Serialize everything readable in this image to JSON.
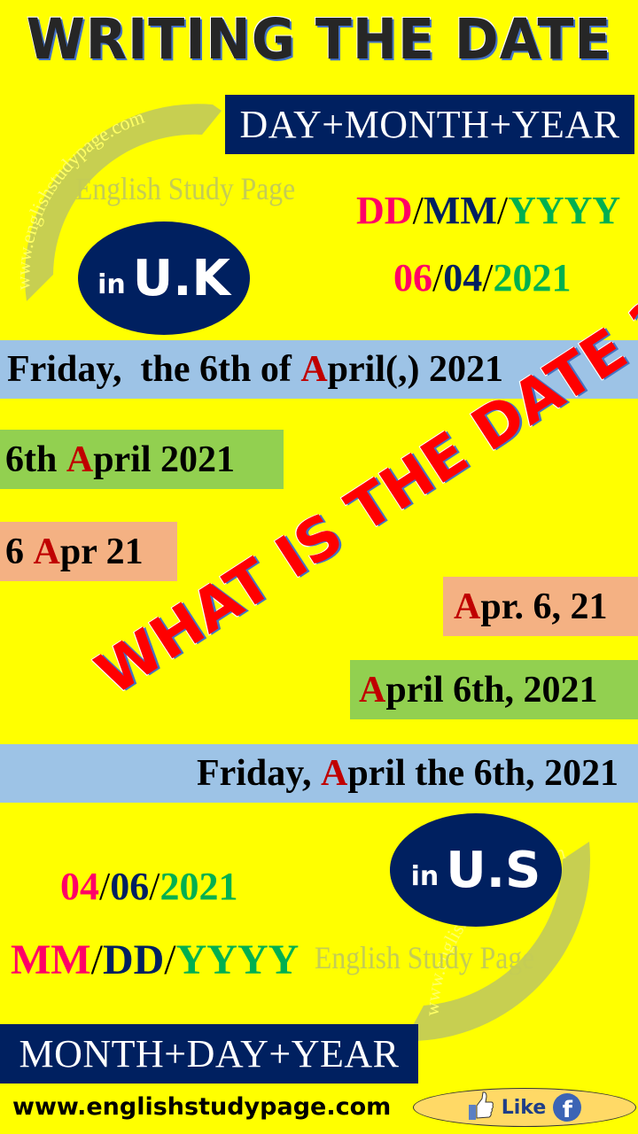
{
  "title": "WRITING THE DATE",
  "watermark": {
    "brand": "English Study Page",
    "arc_url": "www.englishstudypage.com"
  },
  "uk": {
    "order_label": "DAY+MONTH+YEAR",
    "badge_prefix": "in",
    "badge_country": "U.K",
    "format": {
      "day": "DD",
      "sep": "/",
      "month": "MM",
      "year": "YYYY"
    },
    "example": {
      "day": "06",
      "sep": "/",
      "month": "04",
      "year": "2021"
    }
  },
  "examples": [
    {
      "pre": "Friday,  the 6th of ",
      "accent": "A",
      "post": "pril(,) 2021"
    },
    {
      "pre": "6th ",
      "accent": "A",
      "post": "pril 2021"
    },
    {
      "pre": "6 ",
      "accent": "A",
      "post": "pr 21"
    },
    {
      "pre": "",
      "accent": "A",
      "post": "pr. 6, 21"
    },
    {
      "pre": "",
      "accent": "A",
      "post": "pril 6th, 2021"
    },
    {
      "pre": "Friday, ",
      "accent": "A",
      "post": "pril the 6th, 2021"
    }
  ],
  "question": "WHAT IS THE DATE ?",
  "us": {
    "order_label": "MONTH+DAY+YEAR",
    "badge_prefix": "in",
    "badge_country": "U.S",
    "format": {
      "month": "MM",
      "sep": "/",
      "day": "DD",
      "year": "YYYY"
    },
    "example": {
      "month": "04",
      "sep": "/",
      "day": "06",
      "year": "2021"
    }
  },
  "footer": {
    "url": "www.englishstudypage.com",
    "like_label": "Like",
    "like_icon": "thumbs-up-icon",
    "social_icon": "facebook-icon",
    "social_glyph": "f"
  },
  "colors": {
    "background": "#ffff00",
    "navy": "#002060",
    "magenta": "#ff0066",
    "green": "#00b050",
    "accent_red": "#c00000",
    "blue_band": "#9dc3e6",
    "green_band": "#92d050",
    "orange_band": "#f4b183",
    "question_red": "#ff0000"
  }
}
